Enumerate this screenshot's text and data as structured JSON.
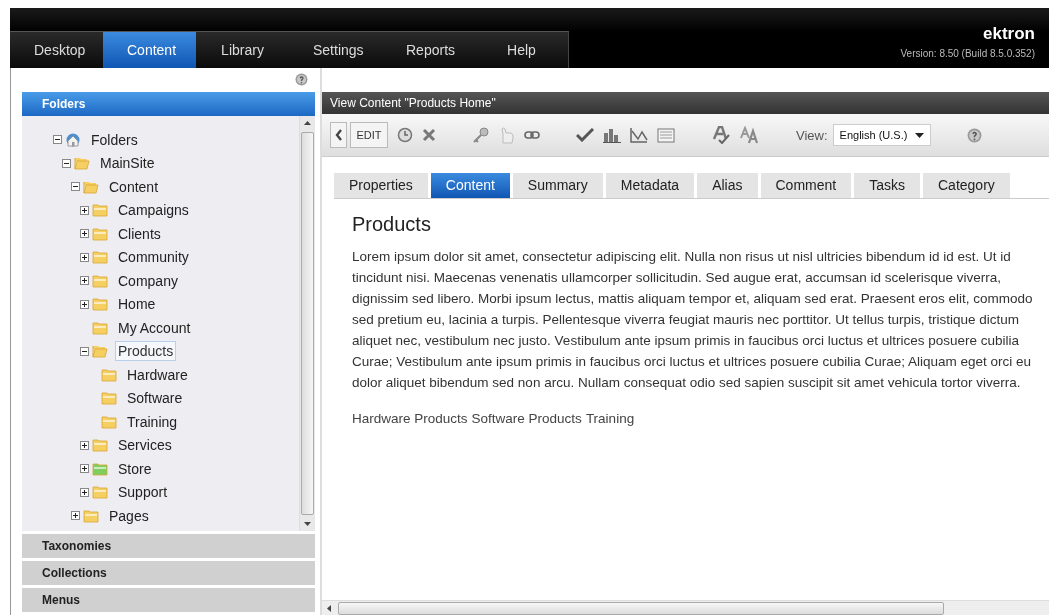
{
  "top_nav": [
    {
      "label": "Desktop",
      "selected": false
    },
    {
      "label": "Content",
      "selected": true
    },
    {
      "label": "Library",
      "selected": false
    },
    {
      "label": "Settings",
      "selected": false
    },
    {
      "label": "Reports",
      "selected": false
    },
    {
      "label": "Help",
      "selected": false
    }
  ],
  "brand": {
    "name": "ektron",
    "version": "Version: 8.50 (Build 8.5.0.352)"
  },
  "sidebar": {
    "sections": [
      {
        "label": "Folders",
        "selected": true
      },
      {
        "label": "Taxonomies",
        "selected": false
      },
      {
        "label": "Collections",
        "selected": false
      },
      {
        "label": "Menus",
        "selected": false
      }
    ],
    "tree": [
      {
        "label": "Folders",
        "kind": "site",
        "expanded": true,
        "selected": false,
        "children": [
          {
            "label": "MainSite",
            "kind": "folder",
            "color": "#f6cf62",
            "expanded": true,
            "selected": false,
            "children": [
              {
                "label": "Content",
                "kind": "folder",
                "color": "#f6cf62",
                "expanded": true,
                "selected": false,
                "children": [
                  {
                    "label": "Campaigns",
                    "kind": "folder",
                    "color": "#f6cf62",
                    "expanded": false,
                    "selected": false
                  },
                  {
                    "label": "Clients",
                    "kind": "folder",
                    "color": "#f6cf62",
                    "expanded": false,
                    "selected": false
                  },
                  {
                    "label": "Community",
                    "kind": "folder",
                    "color": "#f6cf62",
                    "expanded": false,
                    "selected": false
                  },
                  {
                    "label": "Company",
                    "kind": "folder",
                    "color": "#f6cf62",
                    "expanded": false,
                    "selected": false
                  },
                  {
                    "label": "Home",
                    "kind": "folder",
                    "color": "#f6cf62",
                    "expanded": false,
                    "selected": false
                  },
                  {
                    "label": "My Account",
                    "kind": "folder",
                    "color": "#f6cf62",
                    "selected": false
                  },
                  {
                    "label": "Products",
                    "kind": "folder",
                    "color": "#f6cf62",
                    "expanded": true,
                    "selected": true,
                    "children": [
                      {
                        "label": "Hardware",
                        "kind": "folder",
                        "color": "#f6cf62",
                        "selected": false
                      },
                      {
                        "label": "Software",
                        "kind": "folder",
                        "color": "#f6cf62",
                        "selected": false
                      },
                      {
                        "label": "Training",
                        "kind": "folder",
                        "color": "#f6cf62",
                        "selected": false
                      }
                    ]
                  },
                  {
                    "label": "Services",
                    "kind": "folder",
                    "color": "#f6cf62",
                    "expanded": false,
                    "selected": false
                  },
                  {
                    "label": "Store",
                    "kind": "folder",
                    "color": "#7fcf5f",
                    "expanded": false,
                    "selected": false
                  },
                  {
                    "label": "Support",
                    "kind": "folder",
                    "color": "#f6cf62",
                    "expanded": false,
                    "selected": false
                  }
                ]
              },
              {
                "label": "Pages",
                "kind": "folder",
                "color": "#f6cf62",
                "expanded": false,
                "selected": false
              }
            ]
          }
        ]
      }
    ]
  },
  "content": {
    "title": "View Content \"Products Home\"",
    "toolbar": {
      "edit": "EDIT",
      "view_label": "View:",
      "language": "English (U.S.)"
    },
    "tabs": [
      {
        "label": "Properties",
        "selected": false
      },
      {
        "label": "Content",
        "selected": true
      },
      {
        "label": "Summary",
        "selected": false
      },
      {
        "label": "Metadata",
        "selected": false
      },
      {
        "label": "Alias",
        "selected": false
      },
      {
        "label": "Comment",
        "selected": false
      },
      {
        "label": "Tasks",
        "selected": false
      },
      {
        "label": "Category",
        "selected": false
      }
    ],
    "heading": "Products",
    "body": "Lorem ipsum dolor sit amet, consectetur adipiscing elit. Nulla non risus ut nisl ultricies bibendum id id est. Ut id tincidunt nisi. Maecenas venenatis ullamcorper sollicitudin. Sed augue erat, accumsan id scelerisque viverra, dignissim sed libero. Morbi ipsum lectus, mattis aliquam tempor et, aliquam sed erat. Praesent eros elit, commodo sed pretium eu, lacinia a turpis. Pellentesque viverra feugiat mauris nec porttitor. Ut tellus turpis, tristique dictum aliquet nec, vestibulum nec justo. Vestibulum ante ipsum primis in faucibus orci luctus et ultrices posuere cubilia Curae; Vestibulum ante ipsum primis in faucibus orci luctus et ultrices posuere cubilia Curae; Aliquam eget orci eu dolor aliquet bibendum sed non arcu. Nullam consequat odio sed sapien suscipit sit amet vehicula tortor viverra.",
    "links": [
      "Hardware Products",
      "Software Products",
      "Training"
    ]
  }
}
